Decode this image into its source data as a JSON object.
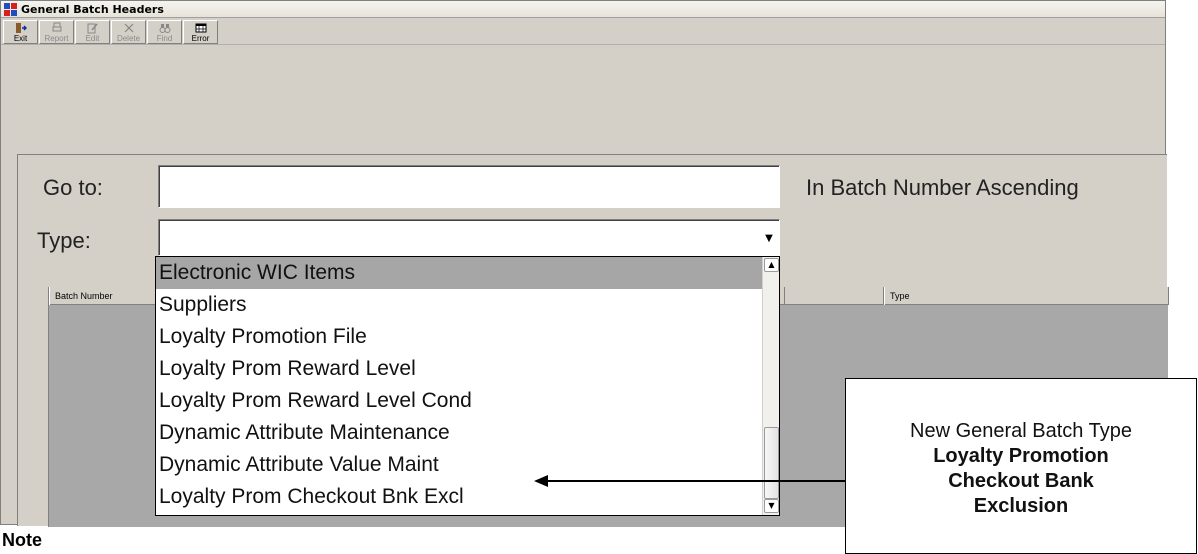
{
  "window": {
    "title": "General Batch Headers"
  },
  "toolbar": {
    "buttons": [
      {
        "label": "Exit",
        "icon": "exit-door-icon",
        "enabled": true
      },
      {
        "label": "Report",
        "icon": "printer-icon",
        "enabled": false
      },
      {
        "label": "Edit",
        "icon": "edit-icon",
        "enabled": false
      },
      {
        "label": "Delete",
        "icon": "delete-x-icon",
        "enabled": false
      },
      {
        "label": "Find",
        "icon": "binoculars-icon",
        "enabled": false
      },
      {
        "label": "Error",
        "icon": "grid-icon",
        "enabled": true
      }
    ]
  },
  "form": {
    "goto_label": "Go to:",
    "goto_value": "",
    "sort_text": "In Batch Number Ascending",
    "type_label": "Type:",
    "type_value": ""
  },
  "grid": {
    "columns": [
      "Batch Number",
      "Type"
    ]
  },
  "dropdown": {
    "items": [
      "Electronic WIC Items",
      "Suppliers",
      "Loyalty Promotion File",
      "Loyalty Prom Reward Level",
      "Loyalty Prom Reward Level Cond",
      "Dynamic Attribute Maintenance",
      "Dynamic Attribute Value Maint",
      "Loyalty Prom Checkout Bnk Excl"
    ],
    "selected_index": 0
  },
  "callout": {
    "line1": "New General Batch Type",
    "line2": "Loyalty Promotion",
    "line3": "Checkout Bank",
    "line4": "Exclusion"
  },
  "note": "Note",
  "colors": {
    "window_bg": "#d4d0c8",
    "grid_bg": "#a8a8a8",
    "selected_item": "#a6a6a6"
  }
}
